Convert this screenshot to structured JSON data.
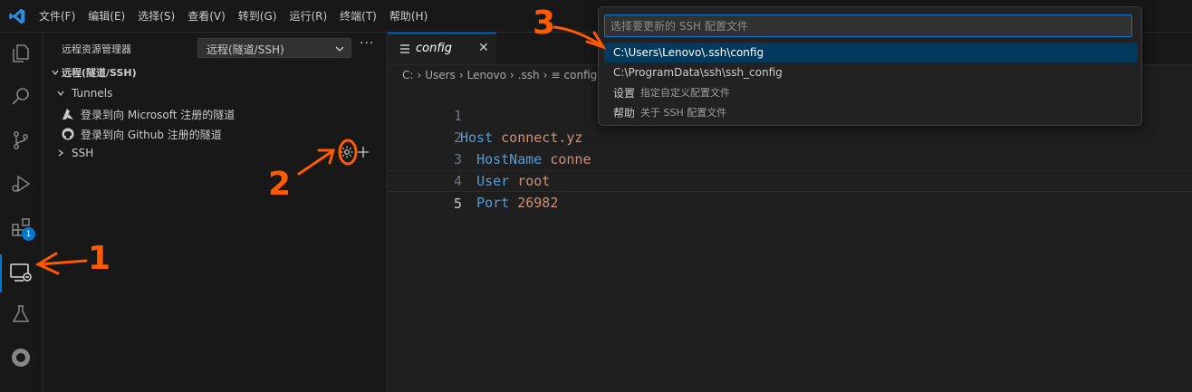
{
  "menu": [
    "文件(F)",
    "编辑(E)",
    "选择(S)",
    "查看(V)",
    "转到(G)",
    "运行(R)",
    "终端(T)",
    "帮助(H)"
  ],
  "activity_bar": {
    "extensions_badge": "1"
  },
  "sidebar": {
    "title": "远程资源管理器",
    "remote_select": "远程(隧道/SSH)",
    "section": "远程(隧道/SSH)",
    "tunnels_label": "Tunnels",
    "tunnel_items": [
      "登录到向 Microsoft 注册的隧道",
      "登录到向 Github 注册的隧道"
    ],
    "ssh_label": "SSH"
  },
  "editor": {
    "tab_label": "config",
    "breadcrumb": [
      "C:",
      "Users",
      "Lenovo",
      ".ssh",
      "config"
    ],
    "lines": [
      {
        "num": "1",
        "key": "Host",
        "value": "connect.yz"
      },
      {
        "num": "2",
        "key": "HostName",
        "value": "conne"
      },
      {
        "num": "3",
        "key": "User",
        "value": "root"
      },
      {
        "num": "4",
        "key": "Port",
        "value": "26982"
      },
      {
        "num": "5",
        "key": "",
        "value": ""
      }
    ]
  },
  "quickpick": {
    "placeholder": "选择要更新的 SSH 配置文件",
    "items": [
      {
        "label": "C:\\Users\\Lenovo\\.ssh\\config",
        "desc": ""
      },
      {
        "label": "C:\\ProgramData\\ssh\\ssh_config",
        "desc": ""
      },
      {
        "label": "设置",
        "desc": "指定自定义配置文件"
      },
      {
        "label": "帮助",
        "desc": "关于 SSH 配置文件"
      }
    ]
  },
  "annotations": {
    "step1": "1",
    "step2": "2",
    "step3": "3",
    "color": "#ff5a00"
  },
  "colors": {
    "accent": "#0078d4",
    "keyword": "#569cd6",
    "string": "#ce9178",
    "selection": "#04395e"
  }
}
